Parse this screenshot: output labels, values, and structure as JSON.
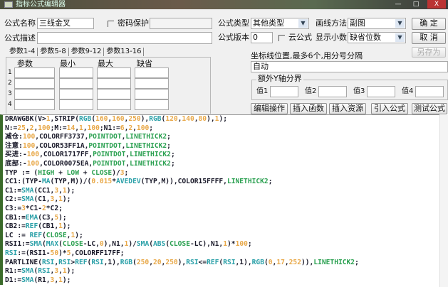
{
  "window": {
    "title": "指标公式编辑器",
    "min": "—",
    "max": "□",
    "close": "X"
  },
  "form": {
    "name_label": "公式名称",
    "name_value": "三线金叉",
    "password_label": "密码保护",
    "password_value": "",
    "desc_label": "公式描述",
    "desc_value": "",
    "type_label": "公式类型",
    "type_value": "其他类型",
    "draw_label": "画线方法",
    "draw_value": "副图",
    "version_label": "公式版本",
    "version_value": "0",
    "cloud_label": "云公式",
    "decimal_label": "显示小数",
    "decimal_value": "缺省位数",
    "ok": "确  定",
    "cancel": "取  消",
    "save_as": "另存为"
  },
  "params": {
    "tabs": [
      "参数1-4",
      "参数5-8",
      "参数9-12",
      "参数13-16"
    ],
    "headers": [
      "参数",
      "最小",
      "最大",
      "缺省"
    ],
    "rows": [
      "1",
      "2",
      "3",
      "4"
    ]
  },
  "axis": {
    "label": "坐标线位置,最多6个,用分号分隔",
    "value": "自动",
    "group_label": "额外Y轴分界",
    "values": [
      "值1",
      "值2",
      "值3",
      "值4"
    ]
  },
  "buttons": [
    "编辑操作",
    "插入函数",
    "插入资源",
    "引入公式",
    "测试公式"
  ],
  "code": [
    [
      [
        "DRAWGBK(V>",
        "n"
      ],
      [
        "1",
        "num"
      ],
      [
        ",STRIP(",
        "n"
      ],
      [
        "RGB",
        "fn"
      ],
      [
        "(",
        "n"
      ],
      [
        "160",
        "num"
      ],
      [
        ",",
        "n"
      ],
      [
        "160",
        "num"
      ],
      [
        ",",
        "n"
      ],
      [
        "250",
        "num"
      ],
      [
        "),",
        "n"
      ],
      [
        "RGB",
        "fn"
      ],
      [
        "(",
        "n"
      ],
      [
        "120",
        "num"
      ],
      [
        ",",
        "n"
      ],
      [
        "140",
        "num"
      ],
      [
        ",",
        "n"
      ],
      [
        "80",
        "num"
      ],
      [
        "),",
        "n"
      ],
      [
        "1",
        "num"
      ],
      [
        ");",
        "n"
      ]
    ],
    [
      [
        "N:=",
        "n"
      ],
      [
        "25",
        "num"
      ],
      [
        ",",
        "n"
      ],
      [
        "2",
        "num"
      ],
      [
        ",",
        "n"
      ],
      [
        "100",
        "num"
      ],
      [
        ";M:=",
        "n"
      ],
      [
        "14",
        "num"
      ],
      [
        ",",
        "n"
      ],
      [
        "1",
        "num"
      ],
      [
        ",",
        "n"
      ],
      [
        "100",
        "num"
      ],
      [
        ";N1:=",
        "n"
      ],
      [
        "6",
        "num"
      ],
      [
        ",",
        "n"
      ],
      [
        "2",
        "num"
      ],
      [
        ",",
        "n"
      ],
      [
        "100",
        "num"
      ],
      [
        ";",
        "n"
      ]
    ],
    [
      [
        "减仓:",
        "n"
      ],
      [
        "100",
        "num"
      ],
      [
        ",COLORFF3737,",
        "n"
      ],
      [
        "POINTDOT",
        "kw"
      ],
      [
        ",",
        "n"
      ],
      [
        "LINETHICK2",
        "kw"
      ],
      [
        ";",
        "n"
      ]
    ],
    [
      [
        "注意:",
        "n"
      ],
      [
        "100",
        "num"
      ],
      [
        ",COLOR53FF1A,",
        "n"
      ],
      [
        "POINTDOT",
        "kw"
      ],
      [
        ",",
        "n"
      ],
      [
        "LINETHICK2",
        "kw"
      ],
      [
        ";",
        "n"
      ]
    ],
    [
      [
        "买进:-",
        "n"
      ],
      [
        "100",
        "num"
      ],
      [
        ",COLOR1717FF,",
        "n"
      ],
      [
        "POINTDOT",
        "kw"
      ],
      [
        ",",
        "n"
      ],
      [
        "LINETHICK2",
        "kw"
      ],
      [
        ";",
        "n"
      ]
    ],
    [
      [
        "底部:-",
        "n"
      ],
      [
        "100",
        "num"
      ],
      [
        ",COLOR0075EA,",
        "n"
      ],
      [
        "POINTDOT",
        "kw"
      ],
      [
        ",",
        "n"
      ],
      [
        "LINETHICK2",
        "kw"
      ],
      [
        ";",
        "n"
      ]
    ],
    [
      [
        "TYP := (",
        "n"
      ],
      [
        "HIGH",
        "kw"
      ],
      [
        " + ",
        "n"
      ],
      [
        "LOW",
        "kw"
      ],
      [
        " + ",
        "n"
      ],
      [
        "CLOSE",
        "kw"
      ],
      [
        ")/",
        "n"
      ],
      [
        "3",
        "num"
      ],
      [
        ";",
        "n"
      ]
    ],
    [
      [
        "CC1:(TYP-",
        "n"
      ],
      [
        "MA",
        "fn"
      ],
      [
        "(TYP,M))/(",
        "n"
      ],
      [
        "0.015",
        "num"
      ],
      [
        "*",
        "n"
      ],
      [
        "AVEDEV",
        "fn"
      ],
      [
        "(TYP,M)),COLOR15FFFF,",
        "n"
      ],
      [
        "LINETHICK2",
        "kw"
      ],
      [
        ";",
        "n"
      ]
    ],
    [
      [
        "C1:=",
        "n"
      ],
      [
        "SMA",
        "fn"
      ],
      [
        "(CC1,",
        "n"
      ],
      [
        "3",
        "num"
      ],
      [
        ",",
        "n"
      ],
      [
        "1",
        "num"
      ],
      [
        ");",
        "n"
      ]
    ],
    [
      [
        "C2:=",
        "n"
      ],
      [
        "SMA",
        "fn"
      ],
      [
        "(C1,",
        "n"
      ],
      [
        "3",
        "num"
      ],
      [
        ",",
        "n"
      ],
      [
        "1",
        "num"
      ],
      [
        ");",
        "n"
      ]
    ],
    [
      [
        "C3:=",
        "n"
      ],
      [
        "3",
        "num"
      ],
      [
        "*C1-",
        "n"
      ],
      [
        "2",
        "num"
      ],
      [
        "*C2;",
        "n"
      ]
    ],
    [
      [
        "CB1:=",
        "n"
      ],
      [
        "EMA",
        "fn"
      ],
      [
        "(C3,",
        "n"
      ],
      [
        "5",
        "num"
      ],
      [
        ");",
        "n"
      ]
    ],
    [
      [
        "CB2:=",
        "n"
      ],
      [
        "REF",
        "fn"
      ],
      [
        "(CB1,",
        "n"
      ],
      [
        "1",
        "num"
      ],
      [
        ");",
        "n"
      ]
    ],
    [
      [
        "LC := ",
        "n"
      ],
      [
        "REF",
        "fn"
      ],
      [
        "(",
        "n"
      ],
      [
        "CLOSE",
        "kw"
      ],
      [
        ",",
        "n"
      ],
      [
        "1",
        "num"
      ],
      [
        ");",
        "n"
      ]
    ],
    [
      [
        "RSI1:=",
        "n"
      ],
      [
        "SMA",
        "fn"
      ],
      [
        "(",
        "n"
      ],
      [
        "MAX",
        "fn"
      ],
      [
        "(",
        "n"
      ],
      [
        "CLOSE",
        "kw"
      ],
      [
        "-LC,",
        "n"
      ],
      [
        "0",
        "num"
      ],
      [
        "),N1,",
        "n"
      ],
      [
        "1",
        "num"
      ],
      [
        ")/",
        "n"
      ],
      [
        "SMA",
        "fn"
      ],
      [
        "(",
        "n"
      ],
      [
        "ABS",
        "fn"
      ],
      [
        "(",
        "n"
      ],
      [
        "CLOSE",
        "kw"
      ],
      [
        "-LC),N1,",
        "n"
      ],
      [
        "1",
        "num"
      ],
      [
        ")*",
        "n"
      ],
      [
        "100",
        "num"
      ],
      [
        ";",
        "n"
      ]
    ],
    [
      [
        "RSI",
        "fn"
      ],
      [
        ":=(RSI1-",
        "n"
      ],
      [
        "50",
        "num"
      ],
      [
        ")*",
        "n"
      ],
      [
        "5",
        "num"
      ],
      [
        ",COLORFF17FF;",
        "n"
      ]
    ],
    [
      [
        "PARTLINE(",
        "n"
      ],
      [
        "RSI",
        "fn"
      ],
      [
        ",",
        "n"
      ],
      [
        "RSI",
        "fn"
      ],
      [
        ">",
        "n"
      ],
      [
        "REF",
        "fn"
      ],
      [
        "(",
        "n"
      ],
      [
        "RSI",
        "fn"
      ],
      [
        ",1),",
        "n"
      ],
      [
        "RGB",
        "fn"
      ],
      [
        "(",
        "n"
      ],
      [
        "250",
        "num"
      ],
      [
        ",",
        "n"
      ],
      [
        "20",
        "num"
      ],
      [
        ",",
        "n"
      ],
      [
        "250",
        "num"
      ],
      [
        "),",
        "n"
      ],
      [
        "RSI",
        "fn"
      ],
      [
        "<=",
        "n"
      ],
      [
        "REF",
        "fn"
      ],
      [
        "(",
        "n"
      ],
      [
        "RSI",
        "fn"
      ],
      [
        ",1),",
        "n"
      ],
      [
        "RGB",
        "fn"
      ],
      [
        "(",
        "n"
      ],
      [
        "0",
        "num"
      ],
      [
        ",",
        "n"
      ],
      [
        "17",
        "num"
      ],
      [
        ",",
        "n"
      ],
      [
        "252",
        "num"
      ],
      [
        ")),",
        "n"
      ],
      [
        "LINETHICK2",
        "kw"
      ],
      [
        ";",
        "n"
      ]
    ],
    [
      [
        "R1:=",
        "n"
      ],
      [
        "SMA",
        "fn"
      ],
      [
        "(",
        "n"
      ],
      [
        "RSI",
        "fn"
      ],
      [
        ",",
        "n"
      ],
      [
        "3",
        "num"
      ],
      [
        ",",
        "n"
      ],
      [
        "1",
        "num"
      ],
      [
        ");",
        "n"
      ]
    ],
    [
      [
        "D1:=",
        "n"
      ],
      [
        "SMA",
        "fn"
      ],
      [
        "(R1,",
        "n"
      ],
      [
        "3",
        "num"
      ],
      [
        ",",
        "n"
      ],
      [
        "1",
        "num"
      ],
      [
        ");",
        "n"
      ]
    ]
  ]
}
